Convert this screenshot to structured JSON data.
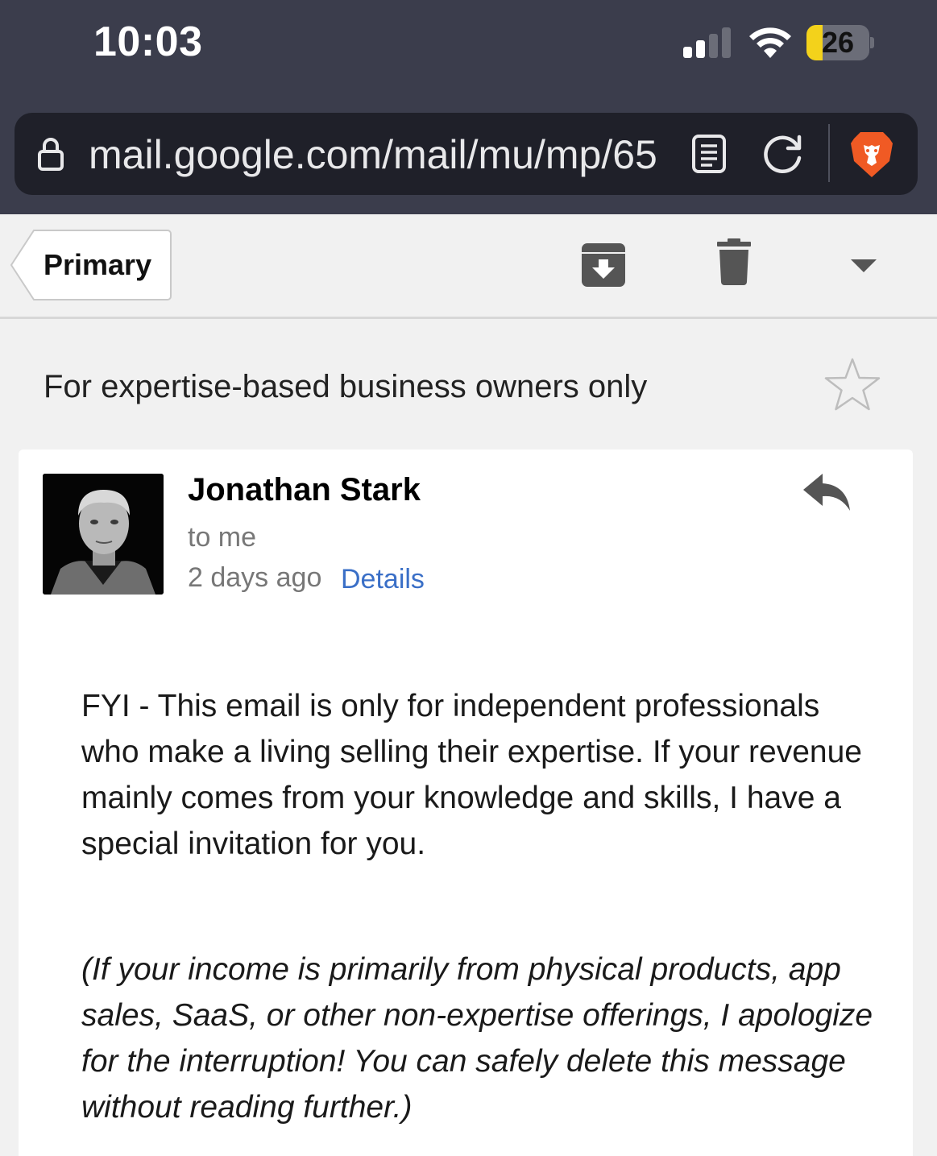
{
  "status_bar": {
    "time": "10:03",
    "battery_level": "26",
    "signal_bars_active": 2,
    "signal_bars_total": 4
  },
  "browser": {
    "url": "mail.google.com/mail/mu/mp/65",
    "icons": [
      "lock-icon",
      "reader-mode-icon",
      "reload-icon",
      "brave-shield-icon"
    ]
  },
  "toolbar": {
    "back_label": "Primary",
    "icons": [
      "archive-icon",
      "trash-icon",
      "dropdown-arrow-icon"
    ]
  },
  "email": {
    "subject": "For expertise-based business owners only",
    "sender": "Jonathan Stark",
    "recipient": "to me",
    "date": "2 days ago",
    "details_link": "Details",
    "paragraphs": [
      "FYI - This email is only for independent professionals who make a living selling their expertise. If your revenue mainly comes from your knowledge and skills, I have a special invitation for you.",
      "(If your income is primarily from physical products, app sales, SaaS, or other non-expertise offerings, I apologize for the interruption! You can safely delete this message without reading further.)"
    ]
  },
  "colors": {
    "status_bar_bg": "#3b3d4c",
    "url_bar_bg": "#1f2029",
    "page_bg": "#f1f1f1",
    "link": "#3a6fc7",
    "battery_fill": "#f3d21b",
    "brave_orange": "#f05a24"
  }
}
